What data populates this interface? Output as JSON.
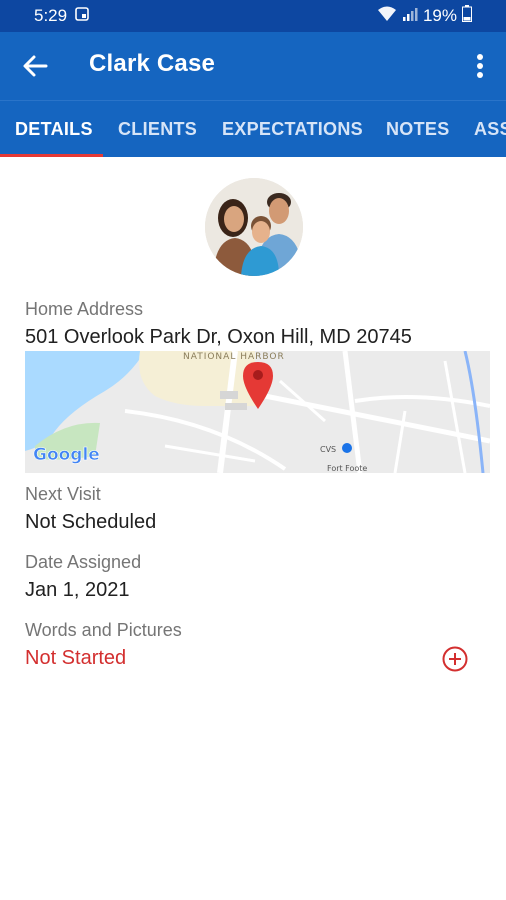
{
  "status_bar": {
    "time": "5:29",
    "battery": "19%"
  },
  "app_bar": {
    "title": "Clark Case"
  },
  "tabs": [
    {
      "label": "DETAILS",
      "active": true
    },
    {
      "label": "CLIENTS",
      "active": false
    },
    {
      "label": "EXPECTATIONS",
      "active": false
    },
    {
      "label": "NOTES",
      "active": false
    },
    {
      "label": "ASS",
      "active": false
    }
  ],
  "details": {
    "home_address_label": "Home Address",
    "home_address": "501 Overlook Park Dr, Oxon Hill, MD 20745",
    "next_visit_label": "Next Visit",
    "next_visit": "Not Scheduled",
    "date_assigned_label": "Date Assigned",
    "date_assigned": "Jan 1, 2021",
    "words_pictures_label": "Words and Pictures",
    "words_pictures_status": "Not Started"
  },
  "map": {
    "place_label": "NATIONAL HARBOR",
    "pharmacy_label": "CVS",
    "park_label": "Fort Foote",
    "brand": "Google"
  },
  "colors": {
    "status_bar": "#0d47a1",
    "app_bar": "#1565c0",
    "tab_indicator": "#e53935",
    "status_red": "#d32f2f"
  }
}
